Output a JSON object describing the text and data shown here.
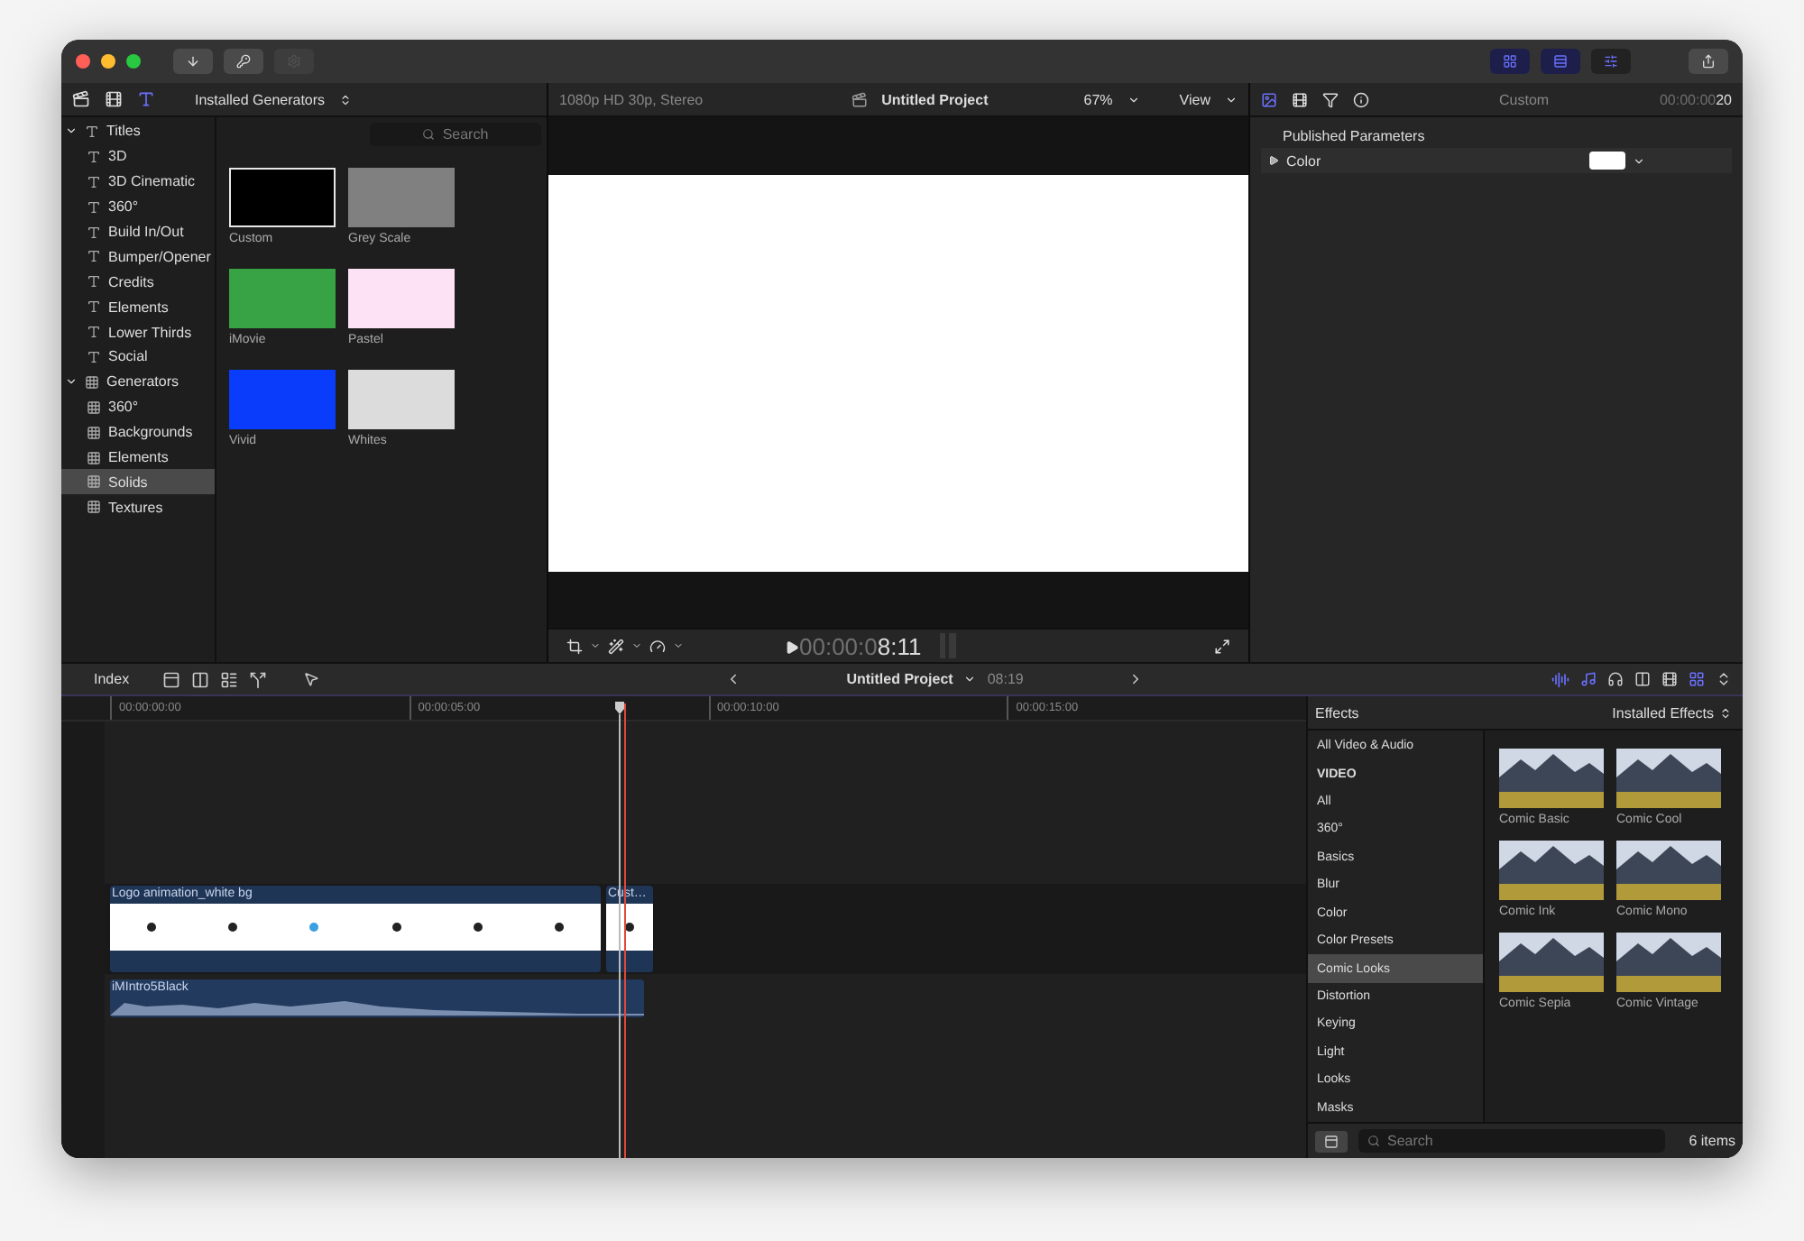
{
  "toolbar": [
    {
      "kind": "import",
      "disabled": false
    },
    {
      "kind": "keywords",
      "disabled": false
    },
    {
      "kind": "tasks",
      "disabled": true
    }
  ],
  "browser": {
    "source": "Installed Generators",
    "search": {
      "placeholder": "Search"
    }
  },
  "library": [
    {
      "label": "Titles",
      "kind": "title",
      "expanded": true,
      "selected": false,
      "children": [
        {
          "label": "3D",
          "selected": false
        },
        {
          "label": "3D Cinematic",
          "selected": false
        },
        {
          "label": "360°",
          "selected": false
        },
        {
          "label": "Build In/Out",
          "selected": false
        },
        {
          "label": "Bumper/Opener",
          "selected": false
        },
        {
          "label": "Credits",
          "selected": false
        },
        {
          "label": "Elements",
          "selected": false
        },
        {
          "label": "Lower Thirds",
          "selected": false
        },
        {
          "label": "Social",
          "selected": false
        }
      ]
    },
    {
      "label": "Generators",
      "kind": "generator",
      "expanded": true,
      "selected": false,
      "children": [
        {
          "label": "360°",
          "selected": false
        },
        {
          "label": "Backgrounds",
          "selected": false
        },
        {
          "label": "Elements",
          "selected": false
        },
        {
          "label": "Solids",
          "selected": true
        },
        {
          "label": "Textures",
          "selected": false
        }
      ]
    }
  ],
  "generators": [
    {
      "label": "Custom",
      "color": "#000000",
      "selected": true
    },
    {
      "label": "Grey Scale",
      "color": "#808080",
      "selected": false
    },
    {
      "label": "iMovie",
      "color": "#37a345",
      "selected": false
    },
    {
      "label": "Pastel",
      "color": "#fde2f5",
      "selected": false
    },
    {
      "label": "Vivid",
      "color": "#0a3cfb",
      "selected": false
    },
    {
      "label": "Whites",
      "color": "#dcdcdc",
      "selected": false
    }
  ],
  "viewer": {
    "format": "1080p HD 30p, Stereo",
    "project": "Untitled Project",
    "zoom": "67%",
    "view": "View",
    "timecode_lead": "00:00:0",
    "timecode": "8:11"
  },
  "inspector": {
    "title": "Custom",
    "time_lead": "00:00:00",
    "time": "20",
    "section": "Published Parameters",
    "parameters": [
      {
        "label": "Color",
        "expanded": false,
        "color": "#ffffff"
      }
    ]
  },
  "timeline": {
    "index": "Index",
    "project": "Untitled Project",
    "duration": "08:19",
    "ruler": [
      "00:00:00:00",
      "00:00:05:00",
      "00:00:10:00",
      "00:00:15:00"
    ],
    "clips": [
      {
        "kind": "video",
        "title": "Logo animation_white bg"
      },
      {
        "kind": "video",
        "title": "Cust…"
      },
      {
        "kind": "audio",
        "title": "iMIntro5Black"
      }
    ]
  },
  "effects": {
    "title": "Effects",
    "source": "Installed Effects",
    "categories": [
      {
        "label": "All Video & Audio",
        "kind": "item",
        "selected": false
      },
      {
        "label": "VIDEO",
        "kind": "header",
        "selected": false
      },
      {
        "label": "All",
        "kind": "item",
        "selected": false
      },
      {
        "label": "360°",
        "kind": "item",
        "selected": false
      },
      {
        "label": "Basics",
        "kind": "item",
        "selected": false
      },
      {
        "label": "Blur",
        "kind": "item",
        "selected": false
      },
      {
        "label": "Color",
        "kind": "item",
        "selected": false
      },
      {
        "label": "Color Presets",
        "kind": "item",
        "selected": false
      },
      {
        "label": "Comic Looks",
        "kind": "item",
        "selected": true
      },
      {
        "label": "Distortion",
        "kind": "item",
        "selected": false
      },
      {
        "label": "Keying",
        "kind": "item",
        "selected": false
      },
      {
        "label": "Light",
        "kind": "item",
        "selected": false
      },
      {
        "label": "Looks",
        "kind": "item",
        "selected": false
      },
      {
        "label": "Masks",
        "kind": "item",
        "selected": false
      }
    ],
    "items": [
      {
        "label": "Comic Basic"
      },
      {
        "label": "Comic Cool"
      },
      {
        "label": "Comic Ink"
      },
      {
        "label": "Comic Mono"
      },
      {
        "label": "Comic Sepia"
      },
      {
        "label": "Comic Vintage"
      }
    ],
    "search": {
      "placeholder": "Search"
    },
    "count": "6 items"
  }
}
